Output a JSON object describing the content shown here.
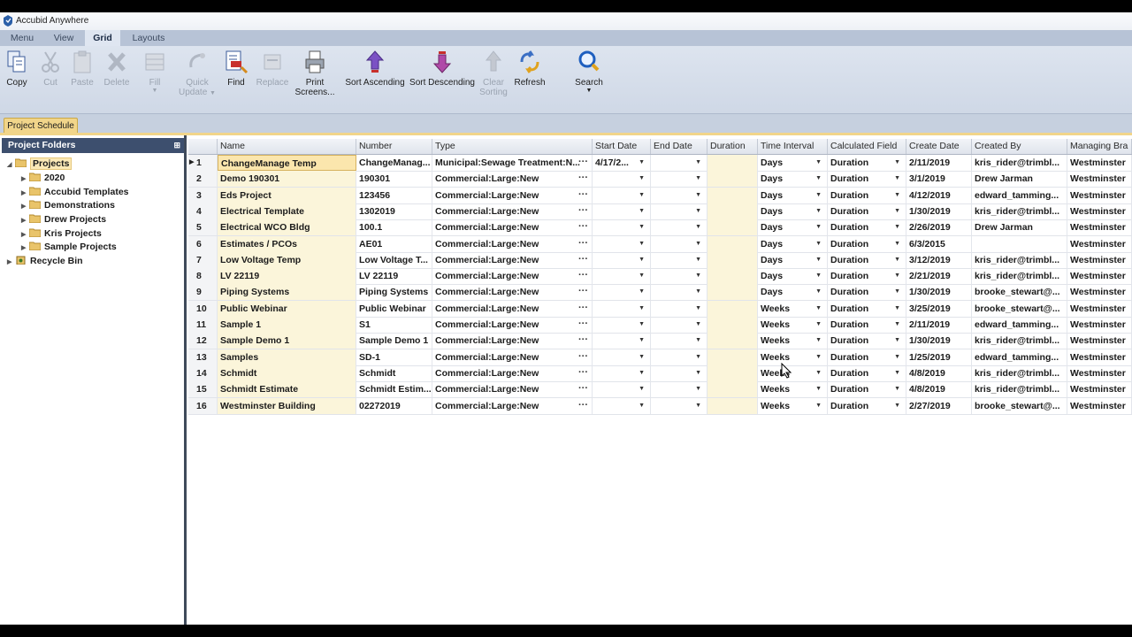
{
  "window": {
    "title": "Accubid Anywhere"
  },
  "ribbon_tabs": [
    "Menu",
    "View",
    "Grid",
    "Layouts"
  ],
  "active_tab": "Grid",
  "ribbon": {
    "copy": "Copy",
    "cut": "Cut",
    "paste": "Paste",
    "delete": "Delete",
    "fill": "Fill",
    "quick_update_1": "Quick",
    "quick_update_2": "Update",
    "find": "Find",
    "replace": "Replace",
    "print_1": "Print",
    "print_2": "Screens...",
    "sort_asc": "Sort Ascending",
    "sort_desc": "Sort Descending",
    "clear_sort_1": "Clear",
    "clear_sort_2": "Sorting",
    "refresh": "Refresh",
    "search": "Search"
  },
  "doc_tab": "Project Schedule",
  "left_panel": {
    "title": "Project Folders",
    "tree": [
      {
        "label": "Projects",
        "level": 0,
        "expanded": true
      },
      {
        "label": "2020",
        "level": 1
      },
      {
        "label": "Accubid Templates",
        "level": 1
      },
      {
        "label": "Demonstrations",
        "level": 1
      },
      {
        "label": "Drew Projects",
        "level": 1
      },
      {
        "label": "Kris Projects",
        "level": 1
      },
      {
        "label": "Sample Projects",
        "level": 1
      },
      {
        "label": "Recycle Bin",
        "level": 0
      }
    ]
  },
  "grid": {
    "columns": [
      "",
      "Name",
      "Number",
      "Type",
      "Start Date",
      "End Date",
      "Duration",
      "Time Interval",
      "Calculated Field",
      "Create Date",
      "Created By",
      "Managing Bra"
    ],
    "rows": [
      {
        "n": "1",
        "name": "ChangeManage Temp",
        "number": "ChangeManag...",
        "type": "Municipal:Sewage Treatment:N...",
        "start": "4/17/2...",
        "end": "",
        "duration": "",
        "interval": "Days",
        "calc": "Duration",
        "created": "2/11/2019",
        "by": "kris_rider@trimbl...",
        "branch": "Westminster"
      },
      {
        "n": "2",
        "name": "Demo 190301",
        "number": "190301",
        "type": "Commercial:Large:New",
        "start": "",
        "end": "",
        "duration": "",
        "interval": "Days",
        "calc": "Duration",
        "created": "3/1/2019",
        "by": "Drew Jarman",
        "branch": "Westminster"
      },
      {
        "n": "3",
        "name": "Eds Project",
        "number": "123456",
        "type": "Commercial:Large:New",
        "start": "",
        "end": "",
        "duration": "",
        "interval": "Days",
        "calc": "Duration",
        "created": "4/12/2019",
        "by": "edward_tamming...",
        "branch": "Westminster"
      },
      {
        "n": "4",
        "name": "Electrical Template",
        "number": "1302019",
        "type": "Commercial:Large:New",
        "start": "",
        "end": "",
        "duration": "",
        "interval": "Days",
        "calc": "Duration",
        "created": "1/30/2019",
        "by": "kris_rider@trimbl...",
        "branch": "Westminster"
      },
      {
        "n": "5",
        "name": "Electrical WCO Bldg",
        "number": "100.1",
        "type": "Commercial:Large:New",
        "start": "",
        "end": "",
        "duration": "",
        "interval": "Days",
        "calc": "Duration",
        "created": "2/26/2019",
        "by": "Drew Jarman",
        "branch": "Westminster"
      },
      {
        "n": "6",
        "name": "Estimates / PCOs",
        "number": "AE01",
        "type": "Commercial:Large:New",
        "start": "",
        "end": "",
        "duration": "",
        "interval": "Days",
        "calc": "Duration",
        "created": "6/3/2015",
        "by": "",
        "branch": "Westminster"
      },
      {
        "n": "7",
        "name": "Low Voltage Temp",
        "number": "Low Voltage T...",
        "type": "Commercial:Large:New",
        "start": "",
        "end": "",
        "duration": "",
        "interval": "Days",
        "calc": "Duration",
        "created": "3/12/2019",
        "by": "kris_rider@trimbl...",
        "branch": "Westminster"
      },
      {
        "n": "8",
        "name": "LV 22119",
        "number": "LV 22119",
        "type": "Commercial:Large:New",
        "start": "",
        "end": "",
        "duration": "",
        "interval": "Days",
        "calc": "Duration",
        "created": "2/21/2019",
        "by": "kris_rider@trimbl...",
        "branch": "Westminster"
      },
      {
        "n": "9",
        "name": "Piping Systems",
        "number": "Piping Systems",
        "type": "Commercial:Large:New",
        "start": "",
        "end": "",
        "duration": "",
        "interval": "Days",
        "calc": "Duration",
        "created": "1/30/2019",
        "by": "brooke_stewart@...",
        "branch": "Westminster"
      },
      {
        "n": "10",
        "name": "Public Webinar",
        "number": "Public Webinar",
        "type": "Commercial:Large:New",
        "start": "",
        "end": "",
        "duration": "",
        "interval": "Weeks",
        "calc": "Duration",
        "created": "3/25/2019",
        "by": "brooke_stewart@...",
        "branch": "Westminster"
      },
      {
        "n": "11",
        "name": "Sample 1",
        "number": "S1",
        "type": "Commercial:Large:New",
        "start": "",
        "end": "",
        "duration": "",
        "interval": "Weeks",
        "calc": "Duration",
        "created": "2/11/2019",
        "by": "edward_tamming...",
        "branch": "Westminster"
      },
      {
        "n": "12",
        "name": "Sample Demo 1",
        "number": "Sample Demo 1",
        "type": "Commercial:Large:New",
        "start": "",
        "end": "",
        "duration": "",
        "interval": "Weeks",
        "calc": "Duration",
        "created": "1/30/2019",
        "by": "kris_rider@trimbl...",
        "branch": "Westminster"
      },
      {
        "n": "13",
        "name": "Samples",
        "number": "SD-1",
        "type": "Commercial:Large:New",
        "start": "",
        "end": "",
        "duration": "",
        "interval": "Weeks",
        "calc": "Duration",
        "created": "1/25/2019",
        "by": "edward_tamming...",
        "branch": "Westminster"
      },
      {
        "n": "14",
        "name": "Schmidt",
        "number": "Schmidt",
        "type": "Commercial:Large:New",
        "start": "",
        "end": "",
        "duration": "",
        "interval": "Weeks",
        "calc": "Duration",
        "created": "4/8/2019",
        "by": "kris_rider@trimbl...",
        "branch": "Westminster"
      },
      {
        "n": "15",
        "name": "Schmidt Estimate",
        "number": "Schmidt Estim...",
        "type": "Commercial:Large:New",
        "start": "",
        "end": "",
        "duration": "",
        "interval": "Weeks",
        "calc": "Duration",
        "created": "4/8/2019",
        "by": "kris_rider@trimbl...",
        "branch": "Westminster"
      },
      {
        "n": "16",
        "name": "Westminster Building",
        "number": "02272019",
        "type": "Commercial:Large:New",
        "start": "",
        "end": "",
        "duration": "",
        "interval": "Weeks",
        "calc": "Duration",
        "created": "2/27/2019",
        "by": "brooke_stewart@...",
        "branch": "Westminster"
      }
    ]
  },
  "colors": {
    "accent_header": "#3d4f6e",
    "ribbon_bg": "#d4dce9",
    "selection": "#fbe6ad",
    "tab_highlight": "#f1d58a"
  }
}
